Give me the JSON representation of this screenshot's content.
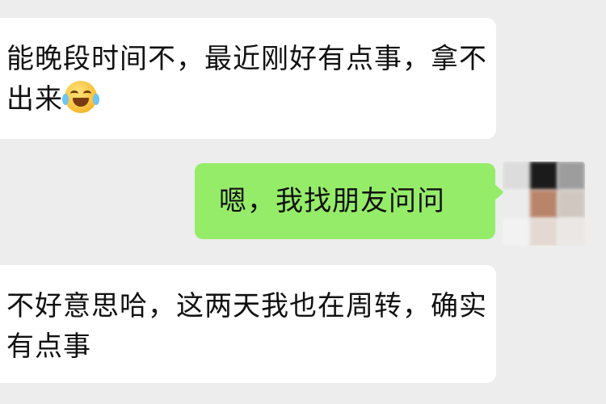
{
  "messages": [
    {
      "id": "msg1",
      "direction": "incoming",
      "text": "能晚段时间不，最近刚好有点事，拿不出来",
      "emoji": "face-with-tears-of-joy-emoji"
    },
    {
      "id": "msg2",
      "direction": "outgoing",
      "text": "嗯，我找朋友问问"
    },
    {
      "id": "msg3",
      "direction": "incoming",
      "text": "不好意思哈，这两天我也在周转，确实有点事"
    }
  ],
  "colors": {
    "background": "#ededed",
    "incoming_bubble": "#ffffff",
    "outgoing_bubble": "#95ec69",
    "text": "#111111"
  }
}
